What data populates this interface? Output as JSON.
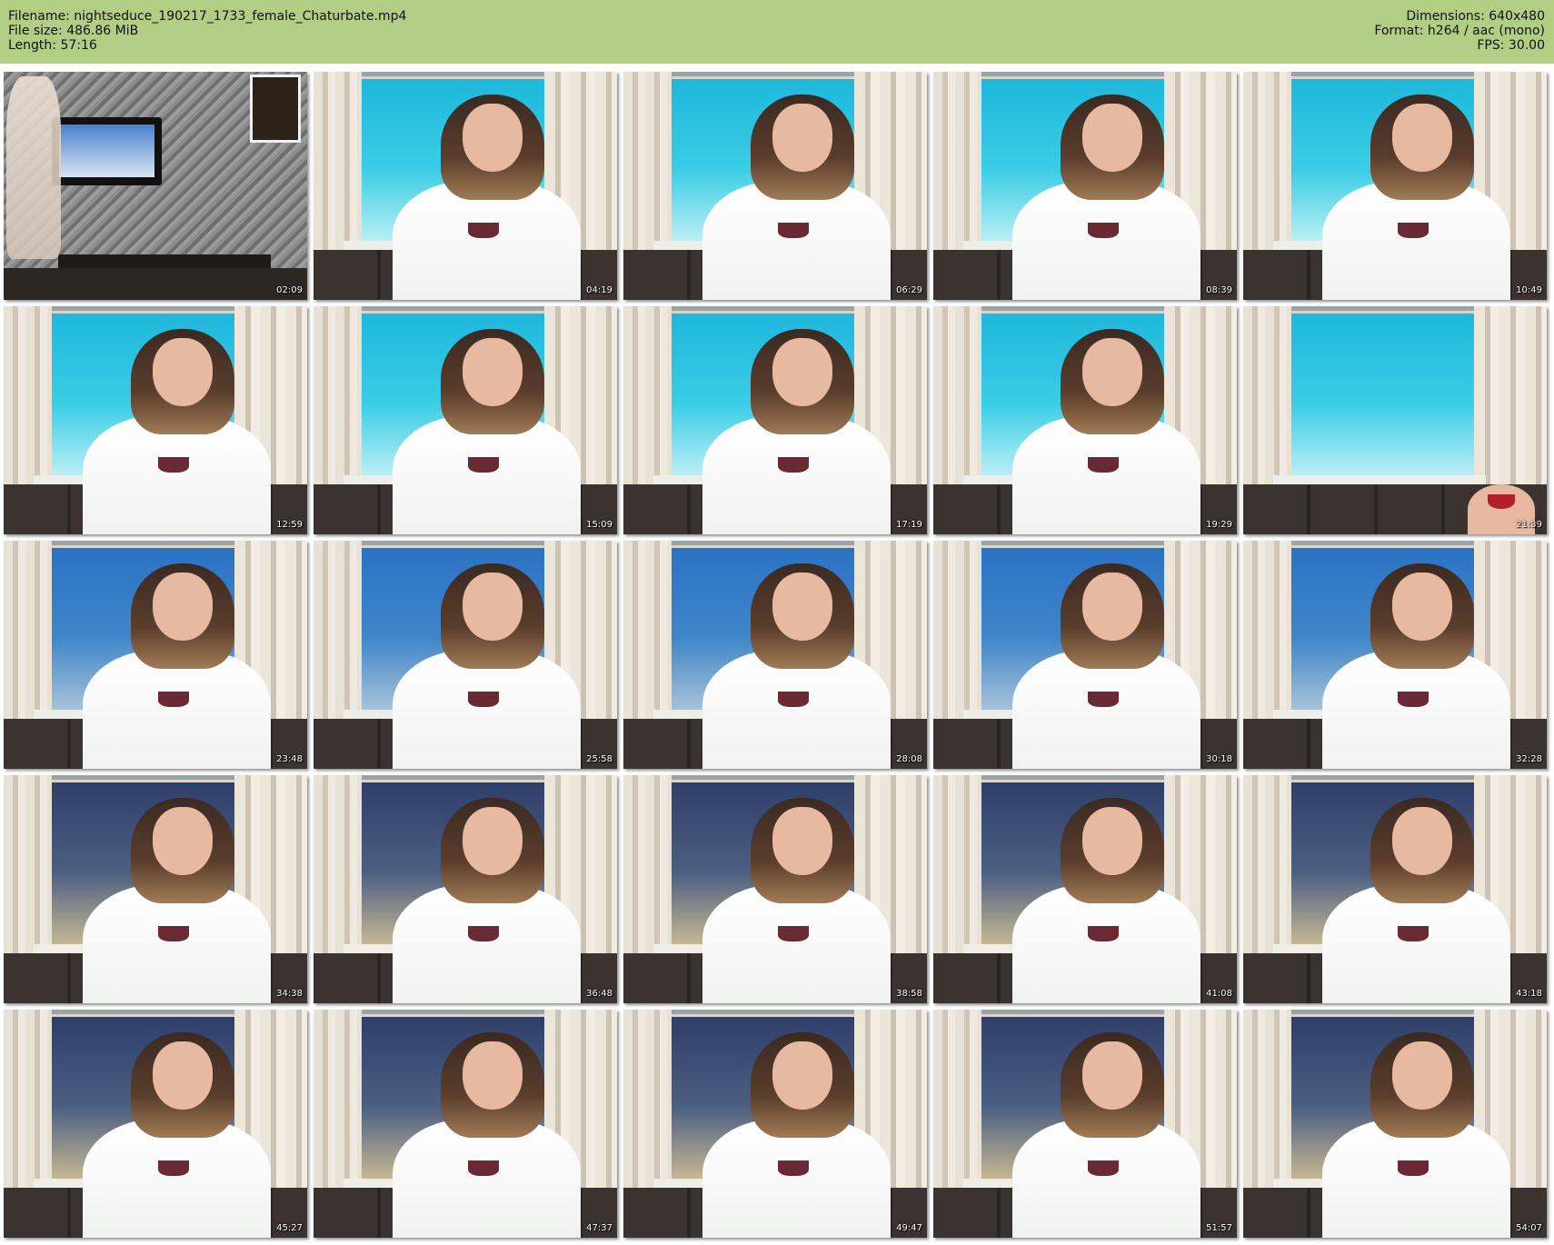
{
  "header": {
    "filename": "Filename: nightseduce_190217_1733_female_Chaturbate.mp4",
    "filesize": "File size: 486.86 MiB",
    "length": "Length: 57:16",
    "dimensions": "Dimensions: 640x480",
    "format": "Format: h264 / aac (mono)",
    "fps": "FPS: 30.00",
    "background": "#b2cd84"
  },
  "thumbnails": [
    {
      "timestamp": "02:09",
      "scene": "room"
    },
    {
      "timestamp": "04:19",
      "scene": "bright"
    },
    {
      "timestamp": "06:29",
      "scene": "bright"
    },
    {
      "timestamp": "08:39",
      "scene": "bright"
    },
    {
      "timestamp": "10:49",
      "scene": "bright"
    },
    {
      "timestamp": "12:59",
      "scene": "bright"
    },
    {
      "timestamp": "15:09",
      "scene": "bright"
    },
    {
      "timestamp": "17:19",
      "scene": "bright"
    },
    {
      "timestamp": "19:29",
      "scene": "bright"
    },
    {
      "timestamp": "21:39",
      "scene": "empty"
    },
    {
      "timestamp": "23:48",
      "scene": "mid"
    },
    {
      "timestamp": "25:58",
      "scene": "mid"
    },
    {
      "timestamp": "28:08",
      "scene": "mid"
    },
    {
      "timestamp": "30:18",
      "scene": "mid"
    },
    {
      "timestamp": "32:28",
      "scene": "mid"
    },
    {
      "timestamp": "34:38",
      "scene": "dark"
    },
    {
      "timestamp": "36:48",
      "scene": "dark"
    },
    {
      "timestamp": "38:58",
      "scene": "dark"
    },
    {
      "timestamp": "41:08",
      "scene": "dark"
    },
    {
      "timestamp": "43:18",
      "scene": "dark"
    },
    {
      "timestamp": "45:27",
      "scene": "dark"
    },
    {
      "timestamp": "47:37",
      "scene": "dark"
    },
    {
      "timestamp": "49:47",
      "scene": "dark"
    },
    {
      "timestamp": "51:57",
      "scene": "dark"
    },
    {
      "timestamp": "54:07",
      "scene": "dark"
    }
  ]
}
